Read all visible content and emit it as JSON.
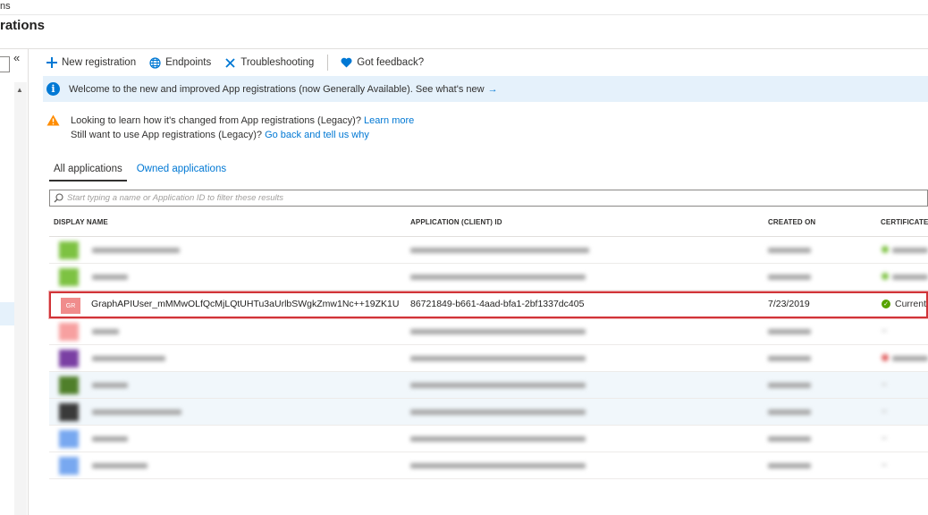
{
  "breadcrumb": "ns",
  "page_title": "rations",
  "nav": {
    "collapse": "«",
    "scroll_up": "▲"
  },
  "toolbar": {
    "new_registration": "New registration",
    "endpoints": "Endpoints",
    "troubleshooting": "Troubleshooting",
    "feedback": "Got feedback?"
  },
  "banner": {
    "text": "Welcome to the new and improved App registrations (now Generally Available). See what's new",
    "arrow": "→"
  },
  "warning": {
    "line1": "Looking to learn how it's changed from App registrations (Legacy)? ",
    "line1_link": "Learn more",
    "line2": "Still want to use App registrations (Legacy)? ",
    "line2_link": "Go back and tell us why"
  },
  "tabs": [
    {
      "label": "All applications",
      "active": true
    },
    {
      "label": "Owned applications",
      "active": false
    }
  ],
  "search": {
    "placeholder": "Start typing a name or Application ID to filter these results"
  },
  "columns": {
    "display_name": "DISPLAY NAME",
    "app_id": "APPLICATION (CLIENT) ID",
    "created_on": "CREATED ON",
    "certificates": "CERTIFICATES"
  },
  "highlighted_row": {
    "initials": "GR",
    "display_name": "GraphAPIUser_mMMwOLfQcMjLQtUHTu3aUrlbSWgkZmw1Nc++19ZK1U",
    "app_id": "86721849-b661-4aad-bfa1-2bf1337dc405",
    "created_on": "7/23/2019",
    "cert_status": "Current",
    "avatar_color": "#f08c8c"
  },
  "blurred_rows": [
    {
      "avatar_color": "#7dc242",
      "cert_color": "#7dc242",
      "tint": false
    },
    {
      "avatar_color": "#7dc242",
      "cert_color": "#7dc242",
      "tint": false
    },
    {
      "avatar_color": "#f7a0a0",
      "cert_color": "",
      "tint": false
    },
    {
      "avatar_color": "#7a3fa3",
      "cert_color": "#e06060",
      "tint": false
    },
    {
      "avatar_color": "#4f7f2a",
      "cert_color": "",
      "tint": true
    },
    {
      "avatar_color": "#3a3a3a",
      "cert_color": "",
      "tint": true
    },
    {
      "avatar_color": "#78a8f0",
      "cert_color": "",
      "tint": false
    },
    {
      "avatar_color": "#78a8f0",
      "cert_color": "",
      "tint": false
    }
  ],
  "colors": {
    "accent": "#0078d4",
    "highlight_border": "#d13438",
    "banner_bg": "#e5f1fb",
    "success": "#57a300"
  }
}
